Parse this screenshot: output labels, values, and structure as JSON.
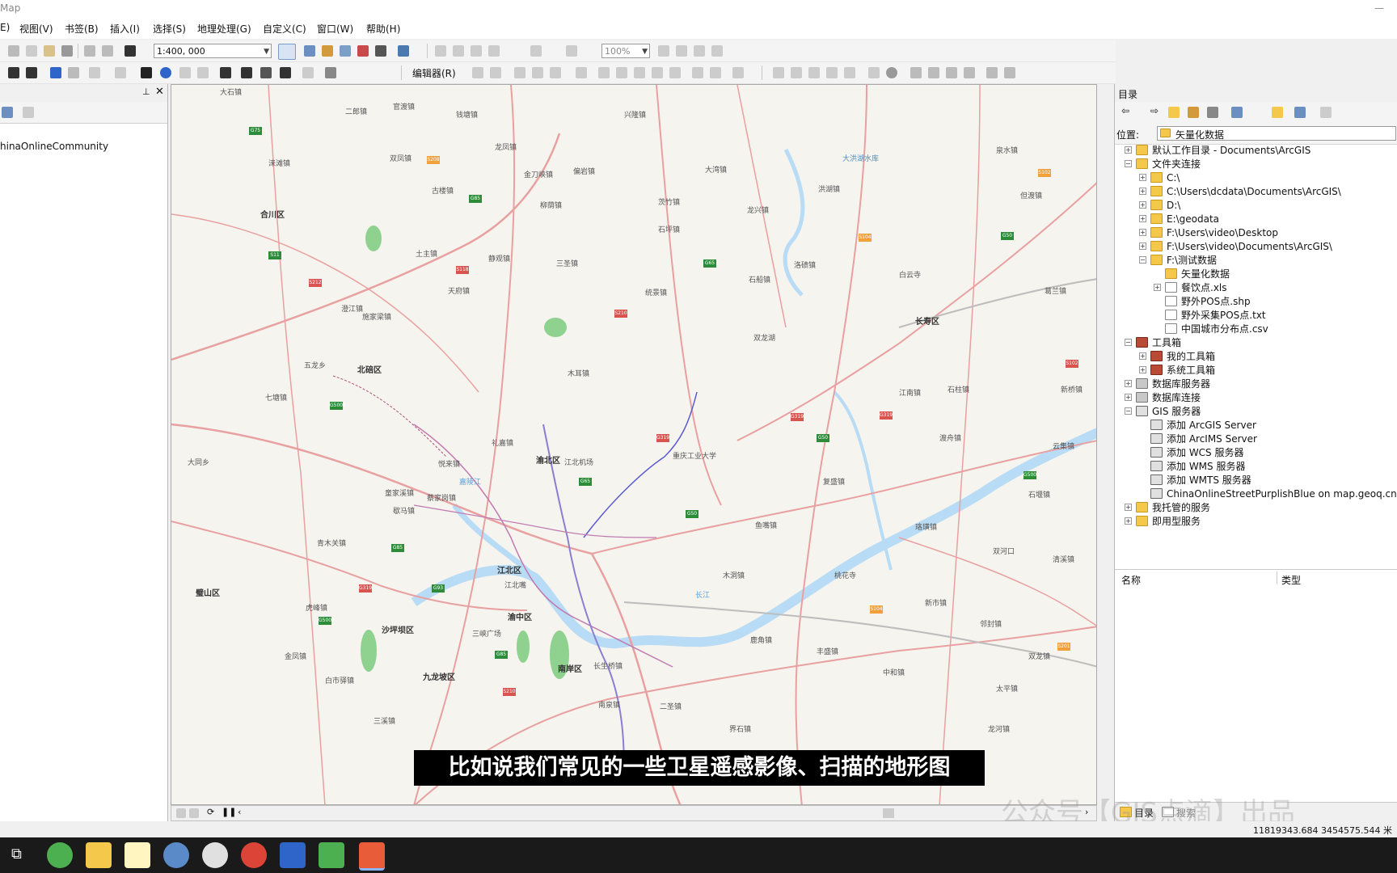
{
  "window": {
    "title": "Map"
  },
  "menu": [
    "E)",
    "视图(V)",
    "书签(B)",
    "插入(I)",
    "选择(S)",
    "地理处理(G)",
    "自定义(C)",
    "窗口(W)",
    "帮助(H)"
  ],
  "toolbar": {
    "scale": "1:400, 000",
    "zoom": "100%",
    "editor_label": "编辑器(R)"
  },
  "toc": {
    "layer_label": "hinaOnlineCommunity"
  },
  "map": {
    "districts": [
      "合川区",
      "北碚区",
      "渝北区",
      "江北区",
      "渝中区",
      "沙坪坝区",
      "九龙坡区",
      "南岸区",
      "长寿区",
      "璧山区"
    ],
    "places": [
      "大石镇",
      "二郎镇",
      "官渡镇",
      "钱塘镇",
      "涞滩镇",
      "双凤镇",
      "古楼镇",
      "龙凤镇",
      "金刀峡镇",
      "偏岩镇",
      "三圣镇",
      "静观镇",
      "天府镇",
      "柳荫镇",
      "龙兴镇",
      "石船镇",
      "洛碛镇",
      "木耳镇",
      "统景镇",
      "大湾镇",
      "兴隆镇",
      "茨竹镇",
      "石坪镇",
      "礼嘉镇",
      "悦来镇",
      "鱼嘴镇",
      "复盛镇",
      "长生桥镇",
      "二圣镇",
      "丰盛镇",
      "鹿角镇",
      "界石镇",
      "白市驿镇",
      "金凤镇",
      "青木关镇",
      "歇马镇",
      "澄江镇",
      "施家梁镇",
      "童家溪镇",
      "蔡家岗镇",
      "双龙湖",
      "南泉镇",
      "土主镇",
      "七塘镇",
      "五龙乡",
      "虎峰镇",
      "三溪镇",
      "大同乡",
      "重庆工业大学",
      "江北机场",
      "石柱镇",
      "珞璜镇",
      "木洞镇",
      "桃花寺",
      "双河口",
      "新市镇",
      "邻封镇",
      "云集镇",
      "但渡镇",
      "江南镇",
      "石堰镇",
      "渡舟镇",
      "葛兰镇",
      "龙河镇",
      "双龙镇",
      "太平镇",
      "清溪镇",
      "泉水镇",
      "新桥镇",
      "中和镇",
      "洪湖镇",
      "白云寺",
      "大洪湖水库"
    ],
    "rivers": [
      "长江",
      "嘉陵江"
    ],
    "labels": [
      "三峡广场",
      "江北嘴"
    ]
  },
  "subtitle": "比如说我们常见的一些卫星遥感影像、扫描的地形图",
  "watermark": "公众号【GIS点滴】出品",
  "catalog": {
    "title": "目录",
    "location_label": "位置:",
    "location_value": "矢量化数据",
    "tree": [
      {
        "label": "默认工作目录 - Documents\\ArcGIS",
        "level": 0,
        "icon": "folder",
        "exp": "+"
      },
      {
        "label": "文件夹连接",
        "level": 0,
        "icon": "folder",
        "exp": "-"
      },
      {
        "label": "C:\\",
        "level": 1,
        "icon": "folder",
        "exp": "+"
      },
      {
        "label": "C:\\Users\\dcdata\\Documents\\ArcGIS\\",
        "level": 1,
        "icon": "folder",
        "exp": "+"
      },
      {
        "label": "D:\\",
        "level": 1,
        "icon": "folder",
        "exp": "+"
      },
      {
        "label": "E:\\geodata",
        "level": 1,
        "icon": "folder",
        "exp": "+"
      },
      {
        "label": "F:\\Users\\video\\Desktop",
        "level": 1,
        "icon": "folder",
        "exp": "+"
      },
      {
        "label": "F:\\Users\\video\\Documents\\ArcGIS\\",
        "level": 1,
        "icon": "folder",
        "exp": "+"
      },
      {
        "label": "F:\\测试数据",
        "level": 1,
        "icon": "folder",
        "exp": "-"
      },
      {
        "label": "矢量化数据",
        "level": 2,
        "icon": "folder",
        "exp": ""
      },
      {
        "label": "餐饮点.xls",
        "level": 2,
        "icon": "file",
        "exp": "+"
      },
      {
        "label": "野外POS点.shp",
        "level": 2,
        "icon": "file",
        "exp": ""
      },
      {
        "label": "野外采集POS点.txt",
        "level": 2,
        "icon": "file",
        "exp": ""
      },
      {
        "label": "中国城市分布点.csv",
        "level": 2,
        "icon": "file",
        "exp": ""
      },
      {
        "label": "工具箱",
        "level": 0,
        "icon": "tool",
        "exp": "-"
      },
      {
        "label": "我的工具箱",
        "level": 1,
        "icon": "tool",
        "exp": "+"
      },
      {
        "label": "系统工具箱",
        "level": 1,
        "icon": "tool",
        "exp": "+"
      },
      {
        "label": "数据库服务器",
        "level": 0,
        "icon": "db",
        "exp": "+"
      },
      {
        "label": "数据库连接",
        "level": 0,
        "icon": "db",
        "exp": "+"
      },
      {
        "label": "GIS 服务器",
        "level": 0,
        "icon": "server",
        "exp": "-"
      },
      {
        "label": "添加 ArcGIS Server",
        "level": 1,
        "icon": "server",
        "exp": ""
      },
      {
        "label": "添加 ArcIMS Server",
        "level": 1,
        "icon": "server",
        "exp": ""
      },
      {
        "label": "添加 WCS 服务器",
        "level": 1,
        "icon": "server",
        "exp": ""
      },
      {
        "label": "添加 WMS 服务器",
        "level": 1,
        "icon": "server",
        "exp": ""
      },
      {
        "label": "添加 WMTS 服务器",
        "level": 1,
        "icon": "server",
        "exp": ""
      },
      {
        "label": "ChinaOnlineStreetPurplishBlue on map.geoq.cn",
        "level": 1,
        "icon": "server",
        "exp": ""
      },
      {
        "label": "我托管的服务",
        "level": 0,
        "icon": "folder",
        "exp": "+"
      },
      {
        "label": "即用型服务",
        "level": 0,
        "icon": "folder",
        "exp": "+"
      }
    ],
    "columns": [
      "名称",
      "类型"
    ],
    "bottom_tabs": [
      "目录",
      "搜索"
    ]
  },
  "status": {
    "coords": "11819343.684  3454575.544 米"
  },
  "colors": {
    "road": "#e8a0a0",
    "water": "#b8dcf5",
    "green": "#8fd18f",
    "metro": "#8a7fd0"
  }
}
